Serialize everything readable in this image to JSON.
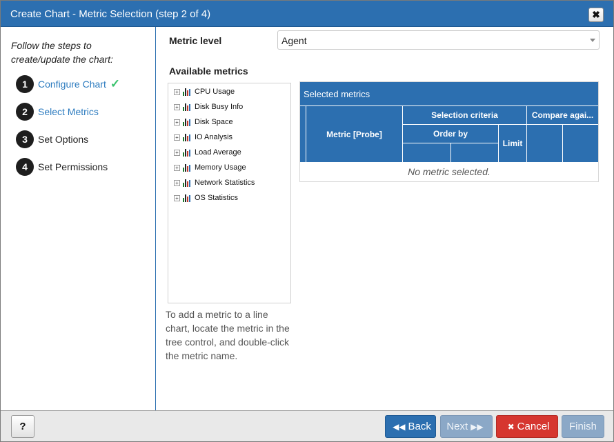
{
  "window": {
    "title": "Create Chart - Metric Selection (step 2 of 4)",
    "close_label": "✖"
  },
  "sidebar": {
    "intro": "Follow the steps to create/update the chart:",
    "steps": [
      {
        "num": "1",
        "label": "Configure Chart",
        "check": "✓"
      },
      {
        "num": "2",
        "label": "Select Metrics"
      },
      {
        "num": "3",
        "label": "Set Options"
      },
      {
        "num": "4",
        "label": "Set Permissions"
      }
    ]
  },
  "metric_level": {
    "label": "Metric level",
    "value": "Agent"
  },
  "available_metrics": {
    "label": "Available metrics",
    "items": [
      "CPU Usage",
      "Disk Busy Info",
      "Disk Space",
      "IO Analysis",
      "Load Average",
      "Memory Usage",
      "Network Statistics",
      "OS Statistics"
    ],
    "expand_symbol": "+"
  },
  "help_text": "To add a metric to a line chart, locate the metric in the tree control, and double-click the metric name.",
  "selected_metrics": {
    "title": "Selected metrics",
    "col_metric": "Metric [Probe]",
    "col_selection": "Selection criteria",
    "col_compare": "Compare agai...",
    "col_order": "Order by",
    "col_limit": "Limit",
    "empty": "No metric selected."
  },
  "footer": {
    "help": "?",
    "back": "Back",
    "next": "Next",
    "cancel": "Cancel",
    "finish": "Finish",
    "back_icon": "◀◀",
    "next_icon": "▶▶",
    "cancel_icon": "✖"
  },
  "colors": {
    "accent": "#2c6fb0",
    "link": "#2c7bbf",
    "danger": "#d6362f",
    "check": "#3cc36e",
    "disabled": "#8ba8c7"
  }
}
